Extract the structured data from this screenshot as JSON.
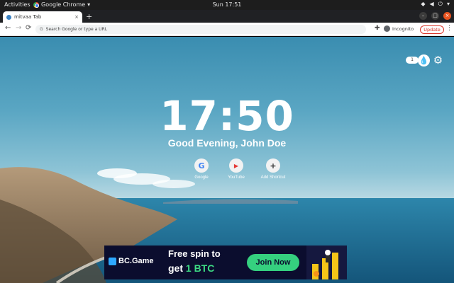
{
  "os_bar": {
    "activities": "Activities",
    "app_name": "Google Chrome",
    "app_arrow": "▾",
    "clock": "Sun 17:51",
    "tray_icons": [
      "network-icon",
      "volume-icon",
      "power-icon",
      "chevron-down-icon"
    ]
  },
  "tab": {
    "title": "mitvaa Tab",
    "close": "×",
    "new_tab": "+"
  },
  "window_buttons": {
    "minimize": "–",
    "maximize": "□",
    "close": "×"
  },
  "toolbar": {
    "back": "←",
    "forward": "→",
    "reload": "⟳",
    "omnibox_icon": "G",
    "omnibox_placeholder": "Search Google or type a URL",
    "incognito_label": "Incognito",
    "update_label": "Update",
    "menu": "⋮",
    "extensions": "✚"
  },
  "newtab": {
    "counter": "1",
    "drop_icon": "💧",
    "gear_icon": "⚙",
    "time": "17:50",
    "greeting": "Good Evening, John Doe",
    "shortcuts": [
      {
        "label": "Google",
        "icon": "G",
        "color": "#4285f4"
      },
      {
        "label": "YouTube",
        "icon": "▶",
        "color": "#e53935"
      },
      {
        "label": "Add Shortcut",
        "icon": "+",
        "color": "#333333"
      }
    ]
  },
  "ad": {
    "brand": "BC.Game",
    "line1": "Free spin to",
    "line2_prefix": "get ",
    "line2_highlight": "1 BTC",
    "cta": "Join Now"
  }
}
